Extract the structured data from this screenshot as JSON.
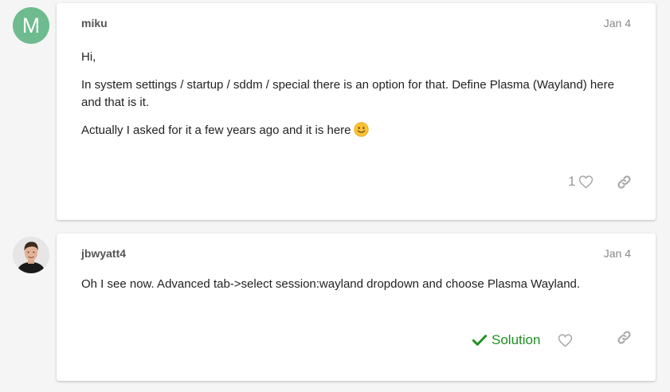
{
  "posts": [
    {
      "avatar_letter": "M",
      "username": "miku",
      "date": "Jan 4",
      "paragraphs": [
        "Hi,",
        "In system settings / startup / sddm / special there is an option for that. Define Plasma (Wayland) here and that is it.",
        "Actually I asked for it a few years ago and it is here"
      ],
      "emoji": "slightly-smiling-face",
      "likes": "1",
      "icons": {
        "like": "heart-icon",
        "share": "link-icon"
      }
    },
    {
      "avatar_type": "photo",
      "username": "jbwyatt4",
      "date": "Jan 4",
      "paragraphs": [
        "Oh I see now. Advanced tab->select session:wayland dropdown and choose Plasma Wayland."
      ],
      "solution_label": "Solution",
      "icons": {
        "solution": "check-icon",
        "like": "heart-icon",
        "share": "link-icon"
      }
    }
  ],
  "colors": {
    "avatar_m": "#6dbb8e",
    "solution_green": "#1e8f1e",
    "icon_gray": "#aaaaaa"
  }
}
